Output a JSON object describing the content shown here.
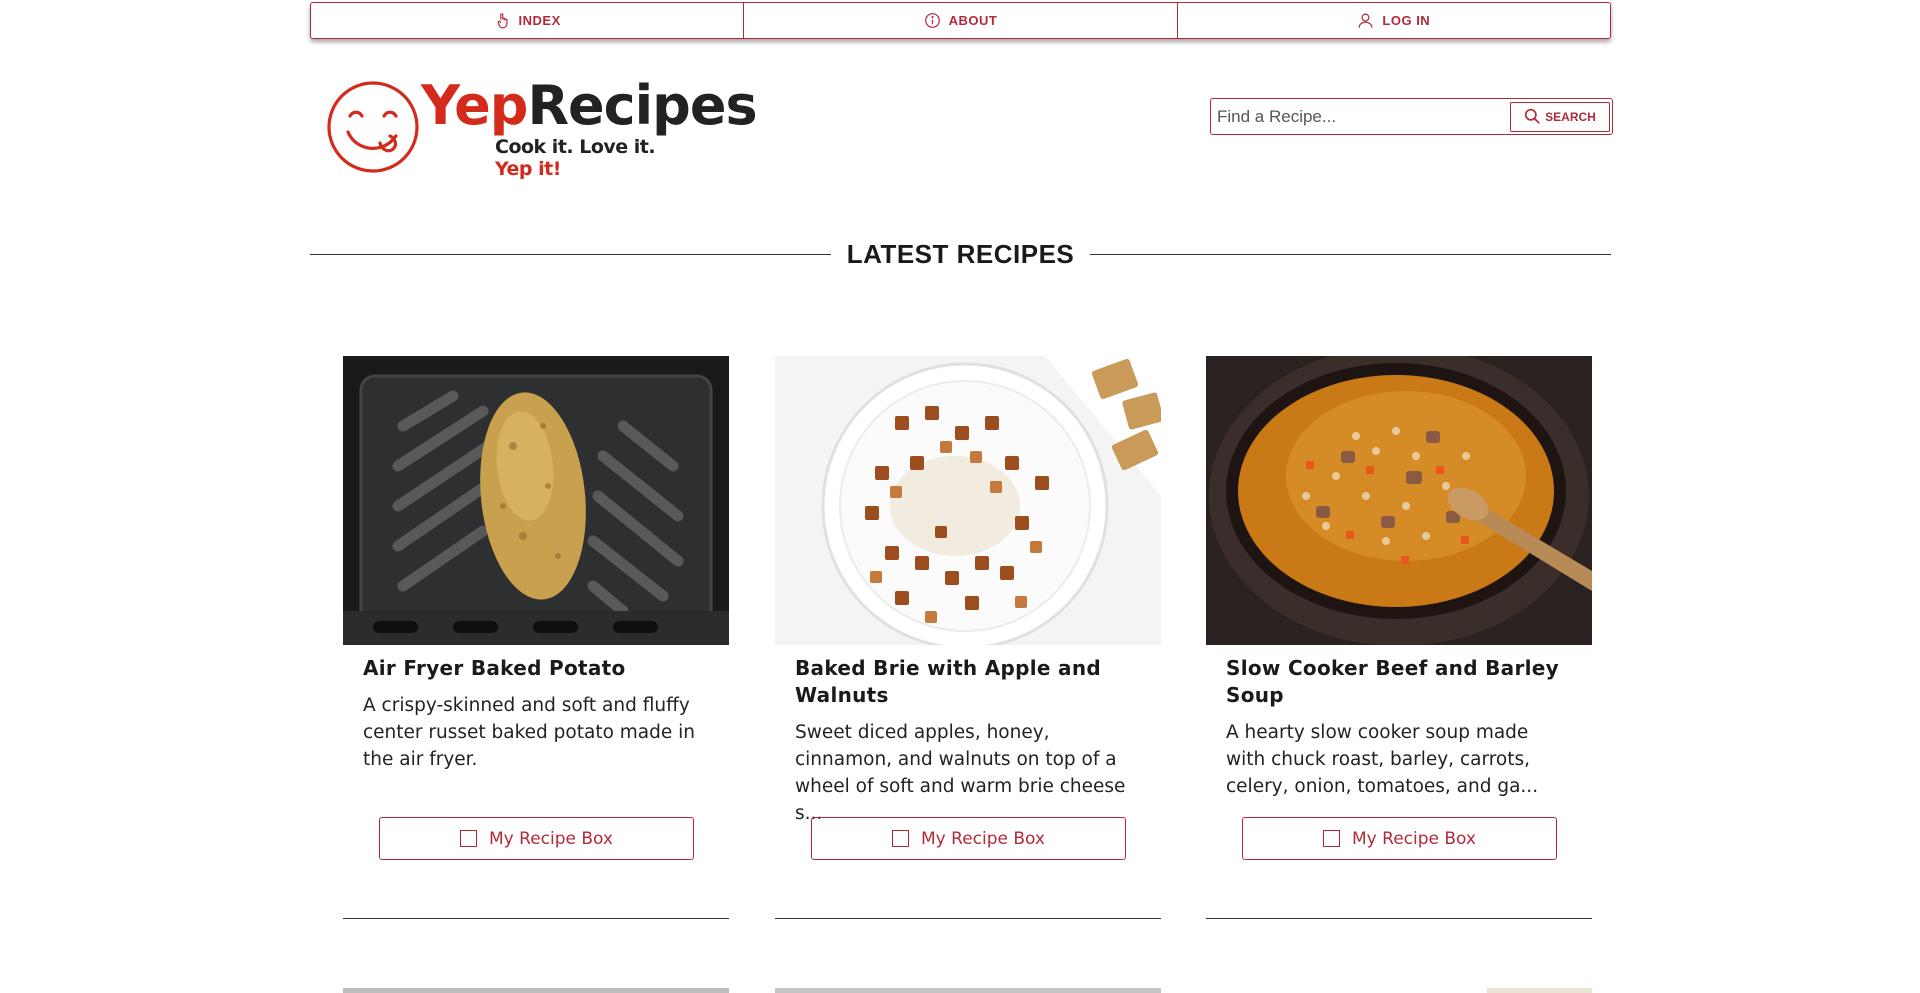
{
  "nav": {
    "items": [
      {
        "label": "INDEX",
        "icon": "hand-pointer-icon"
      },
      {
        "label": "ABOUT",
        "icon": "info-circle-icon"
      },
      {
        "label": "LOG IN",
        "icon": "user-icon"
      }
    ]
  },
  "logo": {
    "word_part1": "Yep",
    "word_part2": "Recipes",
    "tagline_part1": "Cook it. Love it.",
    "tagline_part2": "Yep it!"
  },
  "search": {
    "placeholder": "Find a Recipe...",
    "button_label": "SEARCH"
  },
  "section": {
    "title": "LATEST RECIPES"
  },
  "recipes": [
    {
      "title": "Air Fryer Baked Potato",
      "description": "A crispy-skinned and soft and fluffy center russet baked potato made in the air fryer.",
      "button_label": "My Recipe Box"
    },
    {
      "title": "Baked Brie with Apple and Walnuts",
      "description": "Sweet diced apples, honey, cinnamon, and walnuts on top of a wheel of soft and warm brie cheese s...",
      "button_label": "My Recipe Box"
    },
    {
      "title": "Slow Cooker Beef and Barley Soup",
      "description": "A hearty slow cooker soup made with chuck roast, barley, carrots, celery, onion, tomatoes, and ga...",
      "button_label": "My Recipe Box"
    }
  ],
  "colors": {
    "accent": "#b22a3a",
    "logo_red": "#d42a1c"
  }
}
